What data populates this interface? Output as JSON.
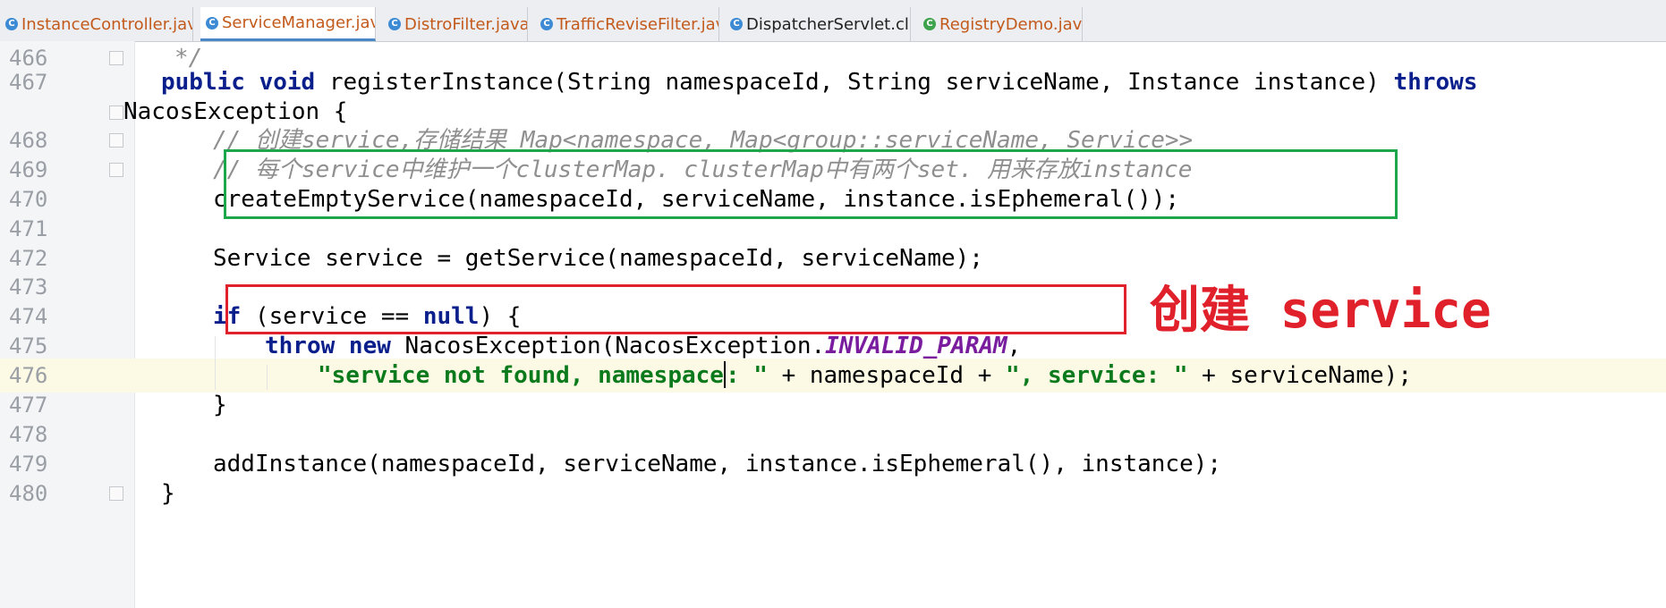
{
  "tabs": [
    {
      "label": "InstanceController.java",
      "active": false
    },
    {
      "label": "ServiceManager.java",
      "active": true
    },
    {
      "label": "DistroFilter.java",
      "active": false
    },
    {
      "label": "TrafficReviseFilter.java",
      "active": false
    },
    {
      "label": "DispatcherServlet.class",
      "active": false
    },
    {
      "label": "RegistryDemo.java",
      "active": false
    }
  ],
  "lines": [
    {
      "num": "466"
    },
    {
      "num": "467"
    },
    {
      "num": ""
    },
    {
      "num": "468"
    },
    {
      "num": "469"
    },
    {
      "num": "470"
    },
    {
      "num": "471"
    },
    {
      "num": "472"
    },
    {
      "num": "473"
    },
    {
      "num": "474"
    },
    {
      "num": "475"
    },
    {
      "num": "476"
    },
    {
      "num": "477"
    },
    {
      "num": "478"
    },
    {
      "num": "479"
    },
    {
      "num": "480"
    }
  ],
  "code": {
    "l466": "*/",
    "l467": {
      "kw1": "public void",
      "t1": " registerInstance(String namespaceId, String serviceName, Instance instance) ",
      "kw2": "throws"
    },
    "l467b": "NacosException {",
    "l468": "// 创建service,存储结果 Map<namespace, Map<group::serviceName, Service>>",
    "l469": "// 每个service中维护一个clusterMap. clusterMap中有两个set. 用来存放instance",
    "l470": "createEmptyService(namespaceId, serviceName, instance.isEphemeral());",
    "l472": "Service service = getService(namespaceId, serviceName);",
    "l474": {
      "kw1": "if",
      "t1": " (service == ",
      "kw2": "null",
      "t2": ") {"
    },
    "l475": {
      "kw1": "throw new",
      "t1": " NacosException(NacosException.",
      "const": "INVALID_PARAM",
      "t2": ","
    },
    "l476": {
      "s1a": "\"service not found, namespace",
      "s1b": ": \"",
      "t1": " + namespaceId + ",
      "s2": "\", service: \"",
      "t2": " + serviceName);"
    },
    "l477": "}",
    "l479": "addInstance(namespaceId, serviceName, instance.isEphemeral(), instance);",
    "l480": "}"
  },
  "annotation": "创建 service",
  "colors": {
    "comment_box": "#1ea64a",
    "highlight_box": "#e0202a",
    "keyword": "#0a1f8c",
    "string": "#0a7a1c"
  }
}
